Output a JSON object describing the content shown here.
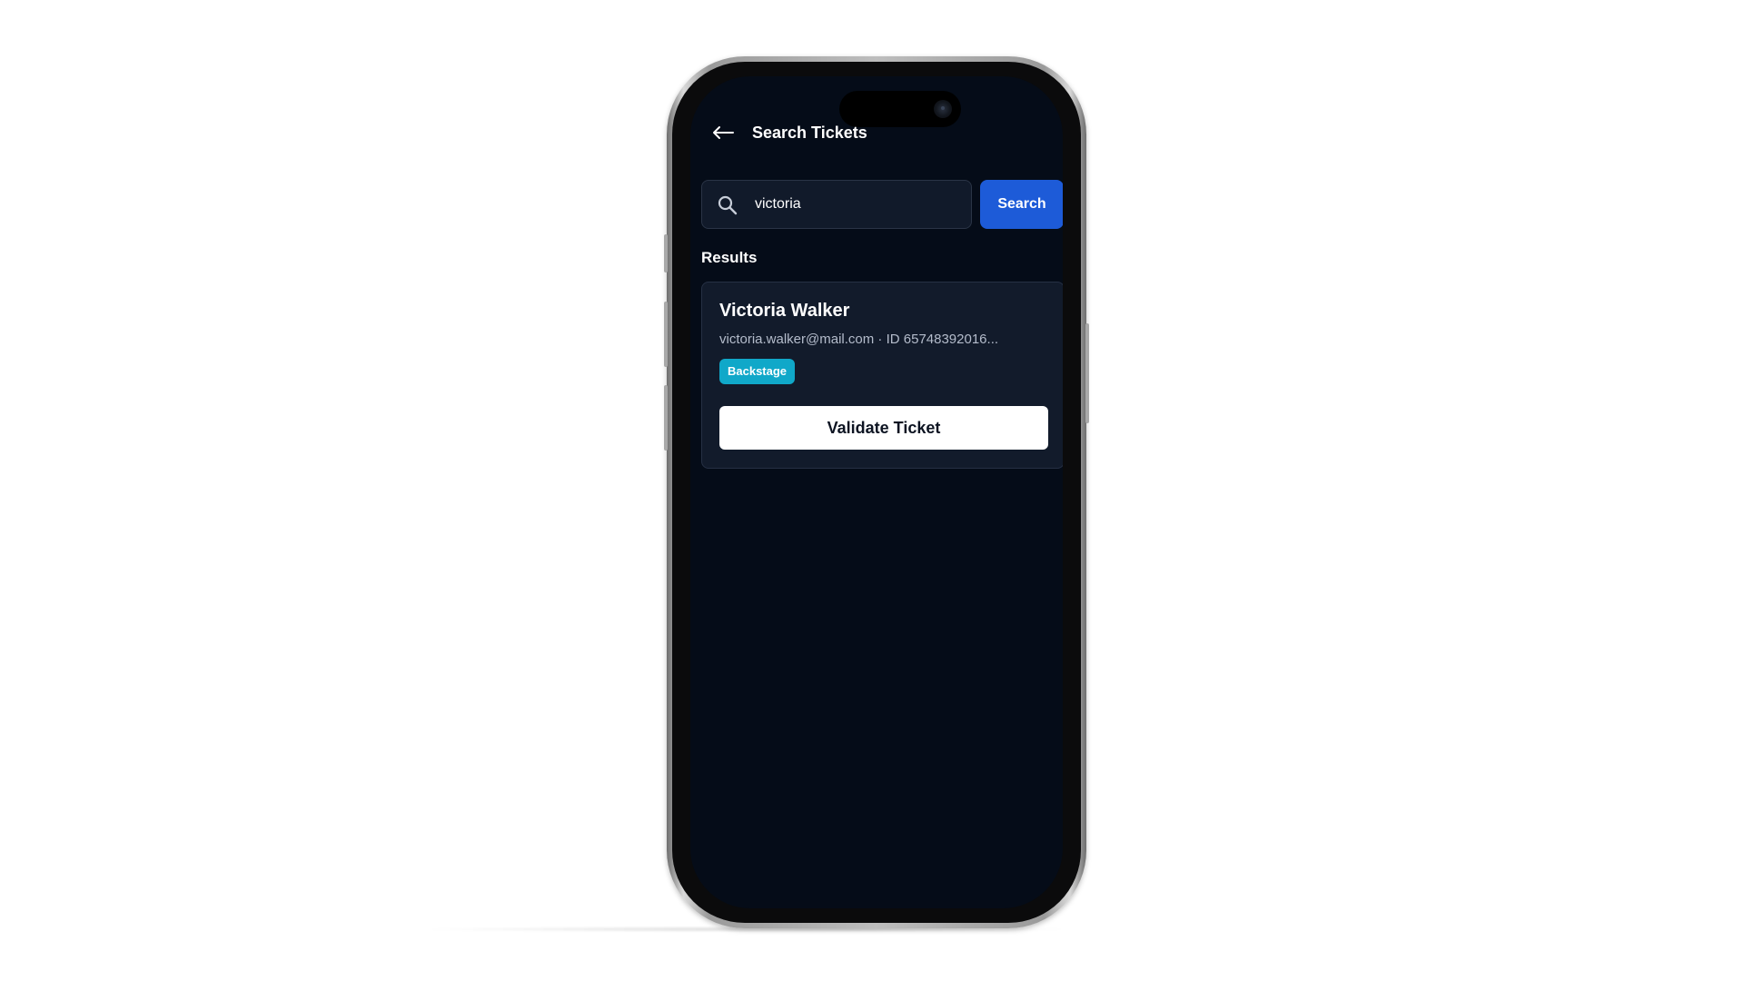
{
  "header": {
    "title": "Search Tickets",
    "back_icon": "arrow-left-icon"
  },
  "search": {
    "query": "victoria",
    "placeholder": "",
    "button_label": "Search",
    "icon": "search-icon"
  },
  "results": {
    "label": "Results",
    "items": [
      {
        "name": "Victoria Walker",
        "meta": "victoria.walker@mail.com · ID 65748392016...",
        "badge": "Backstage",
        "action_label": "Validate Ticket"
      }
    ]
  },
  "colors": {
    "background": "#050c18",
    "accent": "#1d5bd8",
    "badge": "#10a8c9",
    "card": "#121b2b"
  }
}
